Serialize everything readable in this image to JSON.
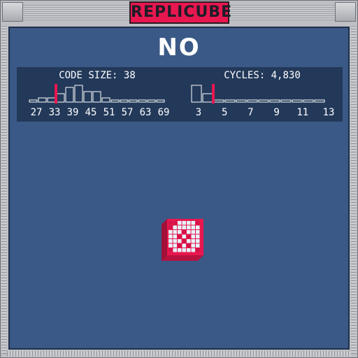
{
  "app": {
    "title": "REPLICUBE"
  },
  "result": {
    "text": "NO"
  },
  "stats": {
    "code_size": {
      "label": "CODE SIZE: 38",
      "value": 38,
      "ticks": [
        "27",
        "33",
        "39",
        "45",
        "51",
        "57",
        "63",
        "69"
      ],
      "bins": [
        1,
        2,
        2,
        4,
        7,
        8,
        5,
        5,
        2,
        1,
        1,
        1,
        1,
        1,
        1
      ],
      "marker_bin": 3
    },
    "cycles": {
      "label": "CYCLES: 4,830",
      "value": 4830,
      "ticks": [
        "3",
        "5",
        "7",
        "9",
        "11",
        "13"
      ],
      "bins": [
        8,
        4,
        1,
        1,
        1,
        1,
        1,
        1,
        1,
        1,
        1,
        1
      ],
      "marker_bin": 2
    }
  },
  "colors": {
    "accent": "#e8174f",
    "screen_bg": "#3a5986",
    "panel_bg": "#23395a",
    "text": "#ffffff",
    "cube_fill": "#e6f4fb"
  },
  "icons": {
    "cube_preview": "voxel-cube-icon"
  }
}
